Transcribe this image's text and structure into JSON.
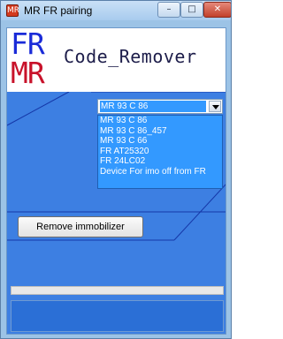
{
  "window": {
    "title": "MR FR pairing",
    "app_icon_glyph": "MR",
    "controls": {
      "minimize": "–",
      "maximize": "□",
      "close": "✕"
    }
  },
  "header": {
    "logo_top": "FR",
    "logo_bottom": "MR",
    "title": "Code_Remover"
  },
  "device_select": {
    "value": "MR 93 C 86",
    "options": [
      "MR 93 C 86",
      "MR 93 C 86_457",
      "MR 93 C 66",
      "FR AT25320",
      "FR 24LC02",
      "Device For imo off from FR"
    ]
  },
  "actions": {
    "remove_label": "Remove immobilizer"
  },
  "progress": {
    "value": 0
  },
  "colors": {
    "panel_blue": "#3d7fe2",
    "select_highlight": "#3399ff",
    "logo_blue": "#1a2bd8",
    "logo_red": "#c8122a"
  },
  "icons": {
    "app": "app-icon",
    "dropdown": "chevron-down-icon"
  }
}
